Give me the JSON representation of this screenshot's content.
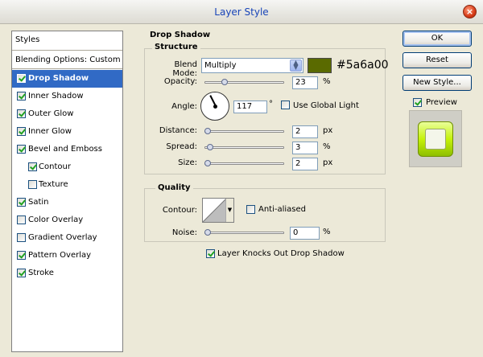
{
  "window": {
    "title": "Layer Style",
    "close_glyph": "×"
  },
  "styles_panel": {
    "header": "Styles",
    "blending": "Blending Options: Custom",
    "items": [
      {
        "label": "Drop Shadow",
        "checked": true,
        "selected": true
      },
      {
        "label": "Inner Shadow",
        "checked": true
      },
      {
        "label": "Outer Glow",
        "checked": true
      },
      {
        "label": "Inner Glow",
        "checked": true
      },
      {
        "label": "Bevel and Emboss",
        "checked": true
      },
      {
        "label": "Contour",
        "checked": true
      },
      {
        "label": "Texture",
        "checked": false
      },
      {
        "label": "Satin",
        "checked": true
      },
      {
        "label": "Color Overlay",
        "checked": false
      },
      {
        "label": "Gradient Overlay",
        "checked": false
      },
      {
        "label": "Pattern Overlay",
        "checked": true
      },
      {
        "label": "Stroke",
        "checked": true
      }
    ]
  },
  "drop_shadow": {
    "title": "Drop Shadow",
    "structure": {
      "title": "Structure",
      "blend_mode_label": "Blend Mode:",
      "blend_mode_value": "Multiply",
      "color": "#5a6a00",
      "color_hex": "#5a6a00",
      "opacity_label": "Opacity:",
      "opacity_value": "23",
      "opacity_unit": "%",
      "opacity_fraction": 0.23,
      "angle_label": "Angle:",
      "angle_value": "117",
      "angle_unit": "°",
      "use_global_light_label": "Use Global Light",
      "use_global_light": false,
      "distance_label": "Distance:",
      "distance_value": "2",
      "distance_unit": "px",
      "distance_fraction": 0.0,
      "spread_label": "Spread:",
      "spread_value": "3",
      "spread_unit": "%",
      "spread_fraction": 0.03,
      "size_label": "Size:",
      "size_value": "2",
      "size_unit": "px",
      "size_fraction": 0.0
    },
    "quality": {
      "title": "Quality",
      "contour_label": "Contour:",
      "anti_aliased_label": "Anti-aliased",
      "anti_aliased": false,
      "noise_label": "Noise:",
      "noise_value": "0",
      "noise_unit": "%",
      "noise_fraction": 0.0
    },
    "knockout_label": "Layer Knocks Out Drop Shadow",
    "knockout": true
  },
  "buttons": {
    "ok": "OK",
    "reset": "Reset",
    "new_style": "New Style...",
    "preview_label": "Preview",
    "preview": true
  },
  "colors": {
    "selection": "#316ac5",
    "title_text": "#1844b8",
    "shadow_color": "#5a6a00",
    "preview_accent": "#c5f20a"
  }
}
